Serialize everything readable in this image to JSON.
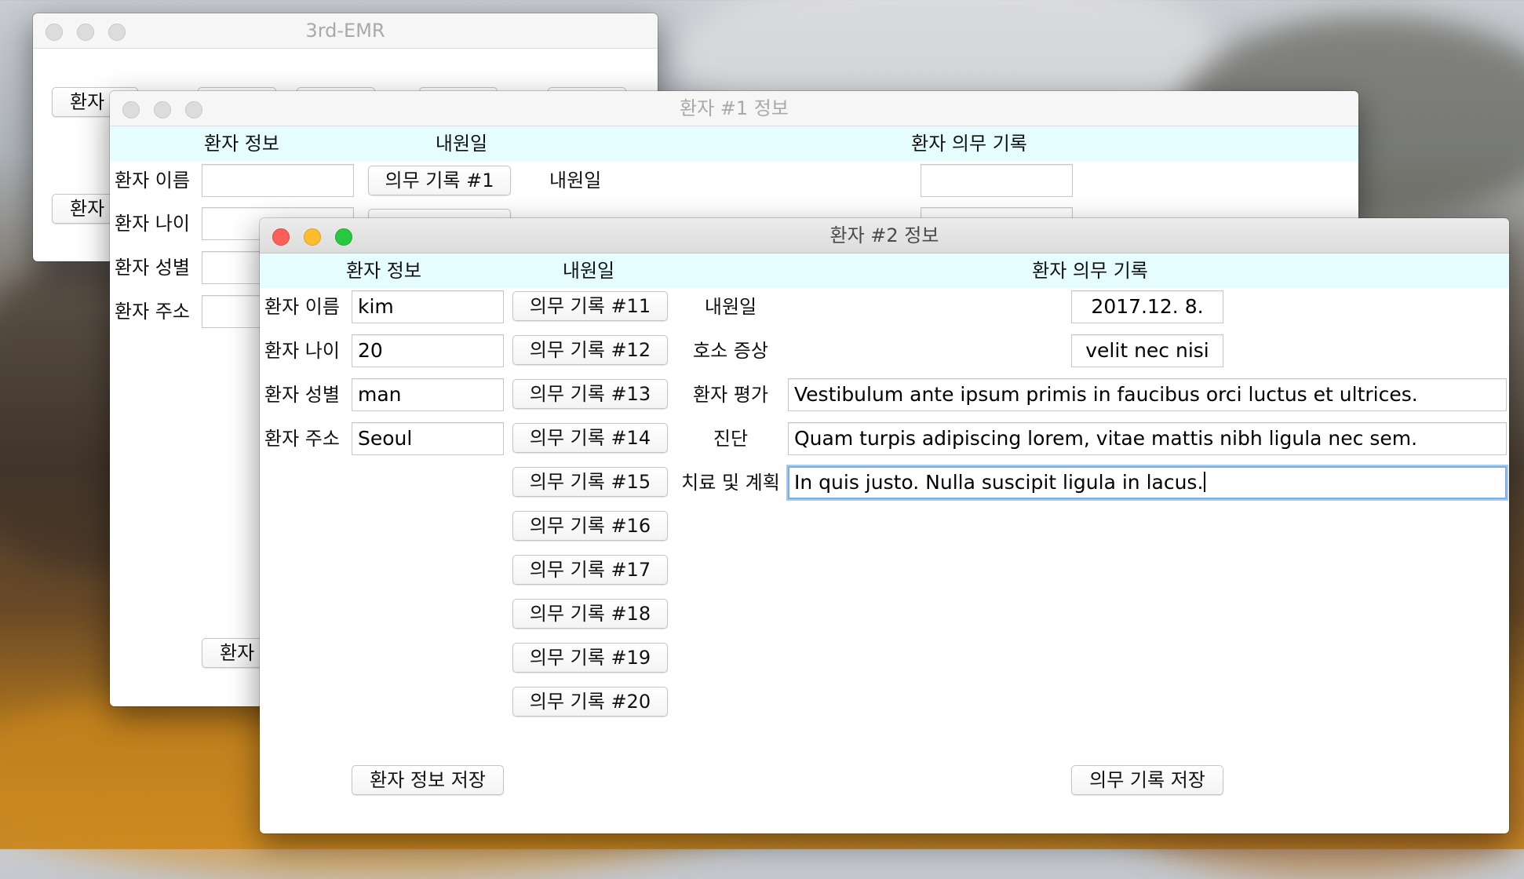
{
  "windows": {
    "main": {
      "title": "3rd-EMR",
      "buttons": [
        "환자",
        "환자"
      ]
    },
    "patient1": {
      "title": "환자 #1 정보",
      "headers": {
        "patient_info": "환자 정보",
        "visit_date": "내원일",
        "medical_record": "환자 의무 기록"
      },
      "labels": {
        "name": "환자 이름",
        "age": "환자 나이",
        "sex": "환자 성별",
        "address": "환자 주소",
        "visit_date": "내원일"
      },
      "record_button": "의무 기록 #1",
      "bottom_button": "환자"
    },
    "patient2": {
      "title": "환자 #2 정보",
      "headers": {
        "patient_info": "환자 정보",
        "visit_date": "내원일",
        "medical_record": "환자 의무 기록"
      },
      "patient": {
        "name_label": "환자 이름",
        "name": "kim",
        "age_label": "환자 나이",
        "age": "20",
        "sex_label": "환자 성별",
        "sex": "man",
        "address_label": "환자 주소",
        "address": "Seoul"
      },
      "record_buttons": [
        "의무 기록 #11",
        "의무 기록 #12",
        "의무 기록 #13",
        "의무 기록 #14",
        "의무 기록 #15",
        "의무 기록 #16",
        "의무 기록 #17",
        "의무 기록 #18",
        "의무 기록 #19",
        "의무 기록 #20"
      ],
      "record": {
        "visit_date_label": "내원일",
        "visit_date": "2017.12. 8.",
        "complaint_label": "호소 증상",
        "complaint": "velit nec nisi",
        "assessment_label": "환자 평가",
        "assessment": "Vestibulum ante ipsum primis in faucibus orci luctus et ultrices.",
        "diagnosis_label": "진단",
        "diagnosis": "Quam turpis adipiscing lorem, vitae mattis nibh ligula nec sem.",
        "plan_label": "치료 및 계획",
        "plan": "In quis justo. Nulla suscipit ligula in lacus."
      },
      "save_patient_button": "환자 정보 저장",
      "save_record_button": "의무 기록 저장"
    }
  }
}
